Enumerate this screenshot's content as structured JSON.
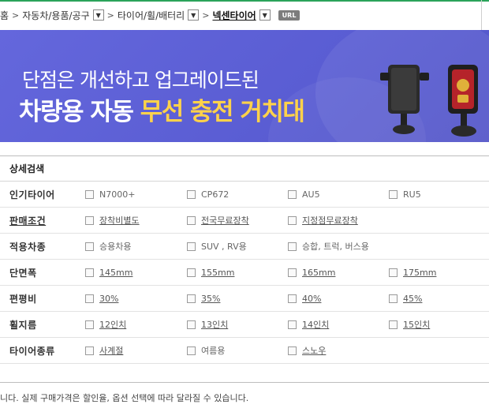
{
  "breadcrumb": {
    "items": [
      {
        "label": "홈"
      },
      {
        "label": "자동차/용품/공구"
      },
      {
        "label": "타이어/휠/배터리"
      },
      {
        "label": "넥센타이어"
      }
    ],
    "url_badge": "URL"
  },
  "banner": {
    "subtitle": "단점은 개선하고 업그레이드된",
    "title_part1": "차량용 자동 ",
    "title_highlight": "무선 충전 거치대"
  },
  "detail_search": {
    "title": "상세검색",
    "rows": [
      {
        "label": "인기타이어",
        "options": [
          "N7000+",
          "CP672",
          "AU5",
          "RU5"
        ]
      },
      {
        "label": "판매조건",
        "options": [
          "장착비별도",
          "전국무료장착",
          "지정점무료장착"
        ]
      },
      {
        "label": "적용차종",
        "options": [
          "승용차용",
          "SUV , RV용",
          "승합, 트럭, 버스용"
        ]
      },
      {
        "label": "단면폭",
        "options": [
          "145mm",
          "155mm",
          "165mm",
          "175mm"
        ]
      },
      {
        "label": "편평비",
        "options": [
          "30%",
          "35%",
          "40%",
          "45%"
        ]
      },
      {
        "label": "휠지름",
        "options": [
          "12인치",
          "13인치",
          "14인치",
          "15인치"
        ]
      },
      {
        "label": "타이어종류",
        "options": [
          "사계절",
          "여름용",
          "스노우"
        ]
      }
    ]
  },
  "notice": "니다. 실제 구매가격은 할인율, 옵션 선택에 따라 달라질 수 있습니다.",
  "colors": {
    "banner_bg": "#5b5fd6",
    "highlight": "#ffd24a",
    "accent_line": "#2aa35a"
  }
}
